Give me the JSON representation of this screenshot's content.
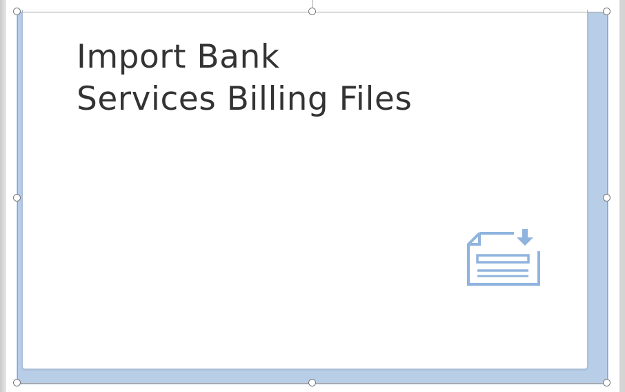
{
  "tile": {
    "title_line1": "Import Bank",
    "title_line2": "Services Billing Files",
    "icon": "file-import-icon"
  },
  "colors": {
    "tile_background": "#ffffff",
    "tile_shadow": "#b8cde6",
    "title_text": "#333333",
    "icon_color": "#8fb4de"
  }
}
